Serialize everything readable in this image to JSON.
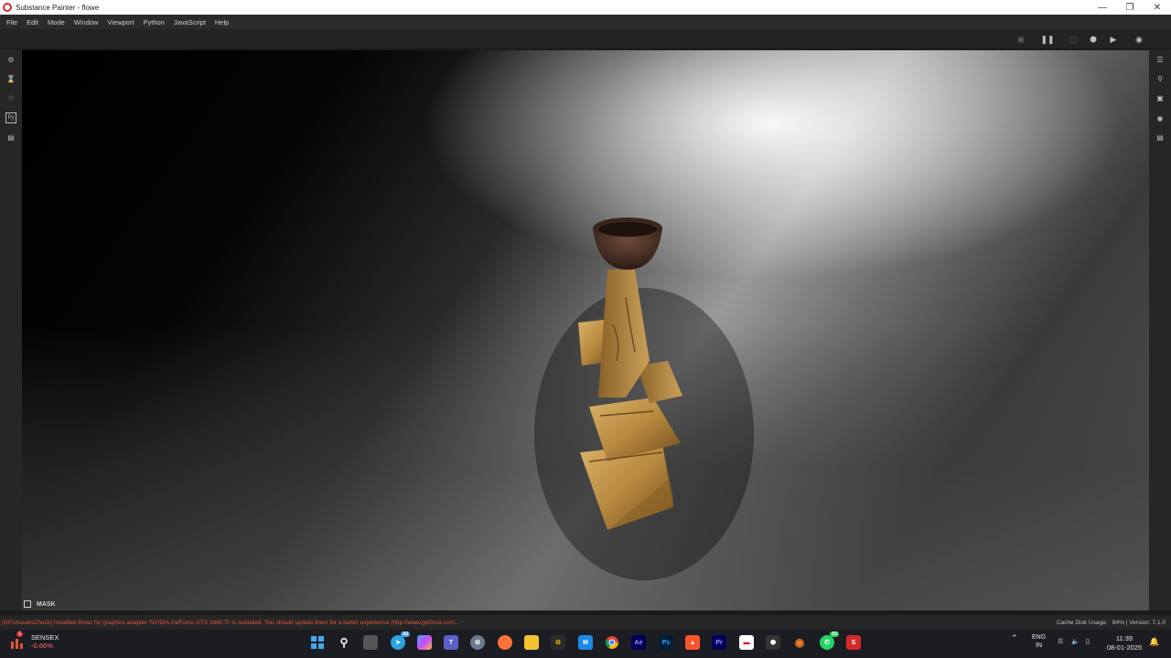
{
  "window": {
    "title": "Substance Painter - flowe"
  },
  "menu": [
    "File",
    "Edit",
    "Mode",
    "Window",
    "Viewport",
    "Python",
    "JavaScript",
    "Help"
  ],
  "viewport": {
    "mask_label": "MASK"
  },
  "status": {
    "message": "[GPUIssuesCheck] Installed driver for graphics adapter 'NVIDIA GeForce GTX 1660 Ti' is outdated. You should update them for a better experience (http://www.geforce.com...",
    "cache_label": "Cache Disk Usage:",
    "cache_value": "84%",
    "version": "| Version: 7.1.0"
  },
  "taskbar": {
    "stock_name": "SENSEX",
    "stock_change": "-0.66%",
    "stock_badge": "1",
    "telegram_badge": "43",
    "whatsapp_badge": "53",
    "ae_label": "Ae",
    "ps_label": "Ps",
    "pr_label": "Pr",
    "lang_top": "ENG",
    "lang_bottom": "IN",
    "time": "11:39",
    "date": "08-01-2025"
  },
  "colors": {
    "accent_error": "#e0553b",
    "viewport_dark": "#000000",
    "model_gold": "#b8893f"
  }
}
